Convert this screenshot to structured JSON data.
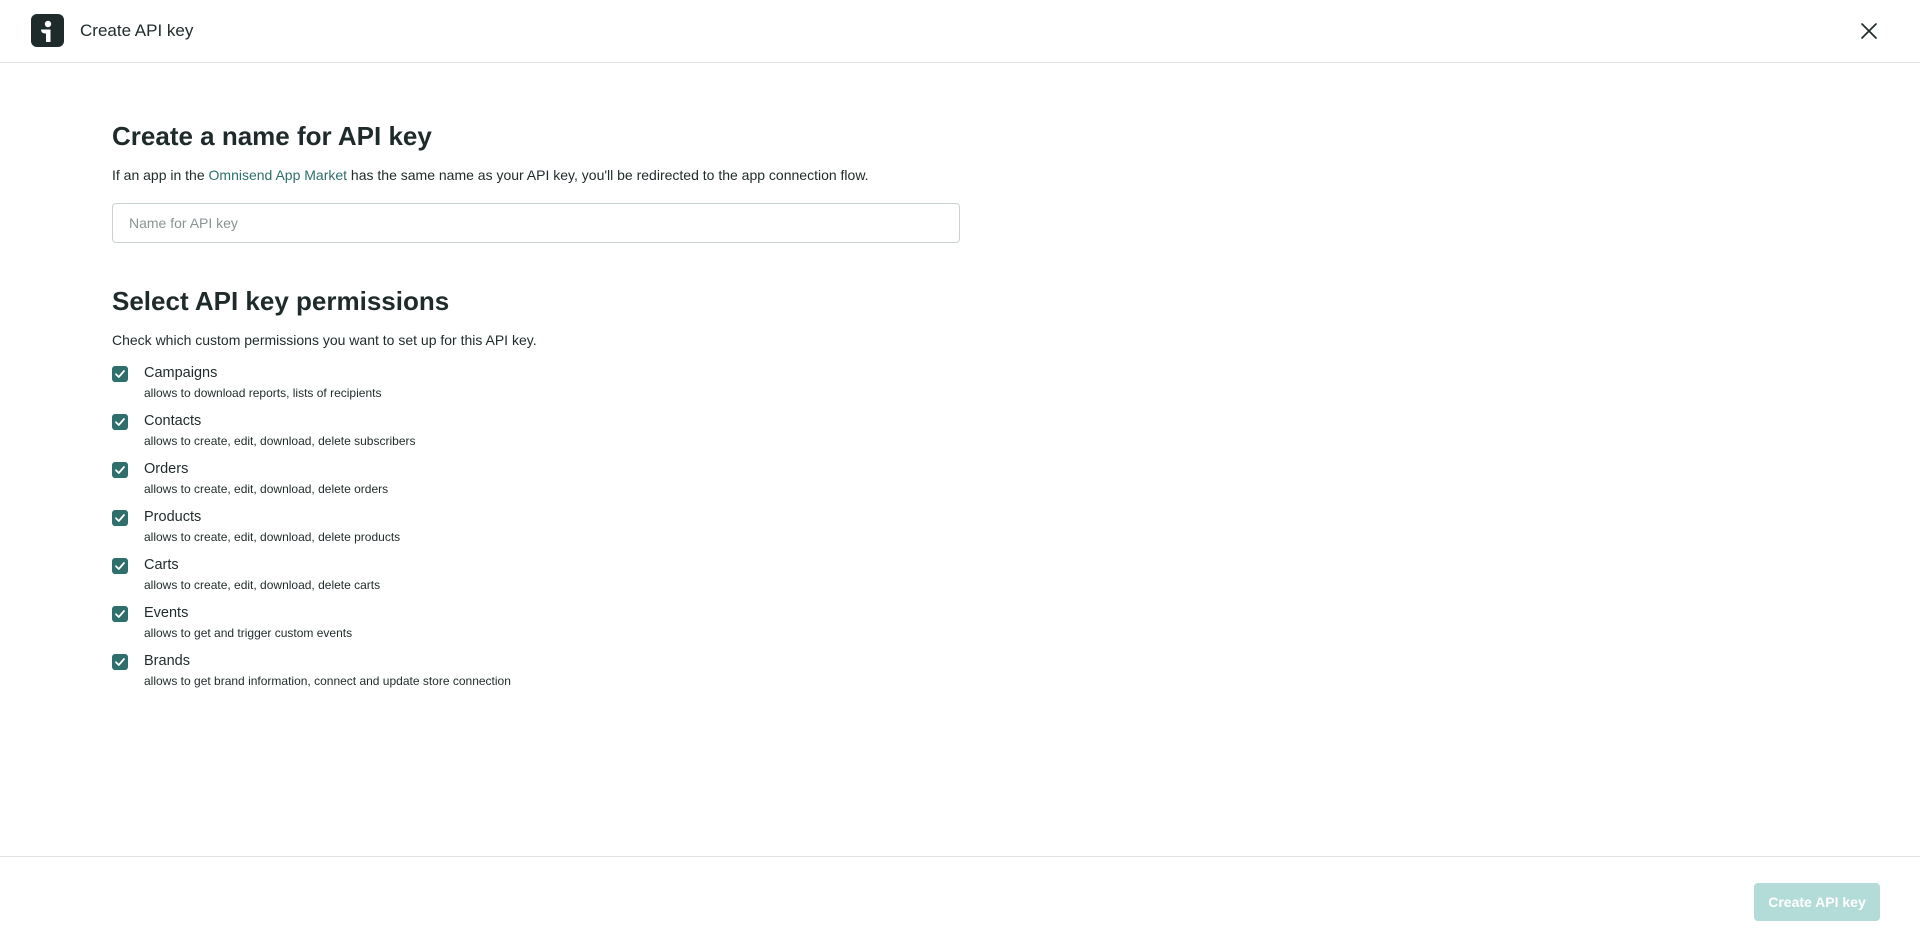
{
  "header": {
    "title": "Create API key",
    "logo_icon": "omnisend-logo-icon",
    "close_icon": "close-icon"
  },
  "name_section": {
    "title": "Create a name for API key",
    "intro_before": "If an app in the ",
    "intro_link": "Omnisend App Market",
    "intro_after": " has the same name as your API key, you'll be redirected to the app connection flow.",
    "input_value": "",
    "input_placeholder": "Name for API key"
  },
  "permissions_section": {
    "title": "Select API key permissions",
    "subtitle": "Check which custom permissions you want to set up for this API key.",
    "items": [
      {
        "label": "Campaigns",
        "description": "allows to download reports, lists of recipients",
        "checked": true
      },
      {
        "label": "Contacts",
        "description": "allows to create, edit, download, delete subscribers",
        "checked": true
      },
      {
        "label": "Orders",
        "description": "allows to create, edit, download, delete orders",
        "checked": true
      },
      {
        "label": "Products",
        "description": "allows to create, edit, download, delete products",
        "checked": true
      },
      {
        "label": "Carts",
        "description": "allows to create, edit, download, delete carts",
        "checked": true
      },
      {
        "label": "Events",
        "description": "allows to get and trigger custom events",
        "checked": true
      },
      {
        "label": "Brands",
        "description": "allows to get brand information, connect and update store connection",
        "checked": true
      }
    ]
  },
  "footer": {
    "create_label": "Create API key",
    "create_disabled": true
  },
  "colors": {
    "accent": "#2e6f6c",
    "button_disabled": "#b3dcd8",
    "text": "#1f2a2a",
    "divider": "#dfe3e3"
  }
}
